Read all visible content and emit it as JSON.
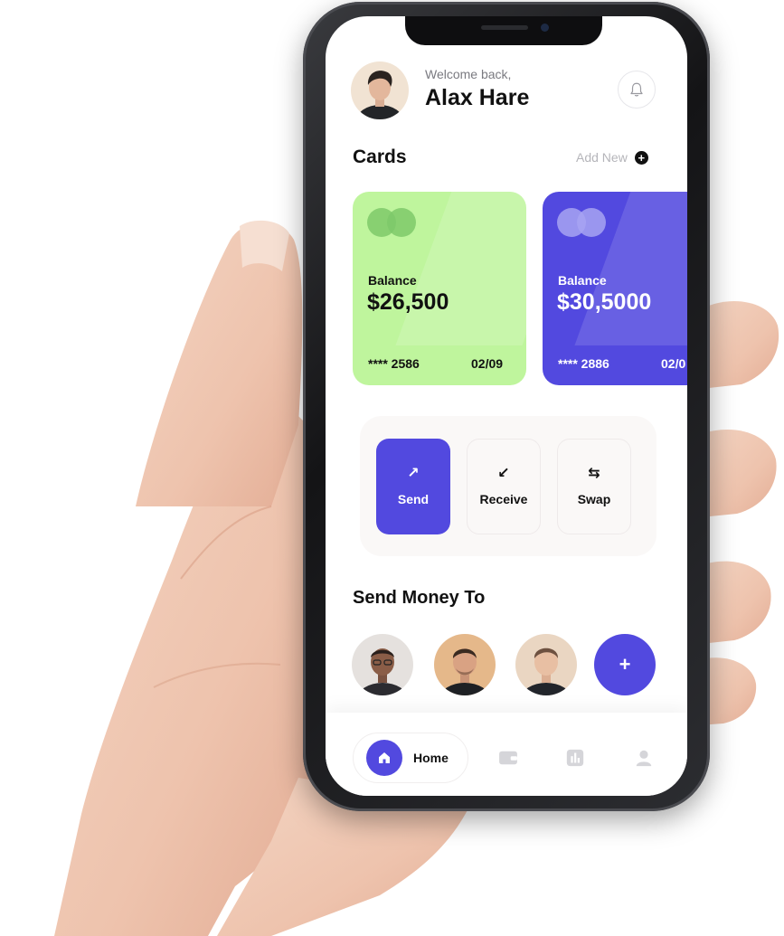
{
  "header": {
    "welcome": "Welcome back,",
    "name": "Alax Hare"
  },
  "cards_section": {
    "title": "Cards",
    "add_new": "Add New"
  },
  "cards": [
    {
      "label": "Balance",
      "value": "$26,500",
      "number": "**** 2586",
      "expiry": "02/09",
      "color": "#bff59d"
    },
    {
      "label": "Balance",
      "value": "$30,5000",
      "number": "**** 2886",
      "expiry": "02/0",
      "color": "#5249df"
    }
  ],
  "actions": {
    "send": "Send",
    "receive": "Receive",
    "swap": "Swap"
  },
  "send_money": {
    "title": "Send Money To"
  },
  "nav": {
    "home": "Home"
  },
  "colors": {
    "accent": "#5249df",
    "card_green": "#bff59d"
  }
}
